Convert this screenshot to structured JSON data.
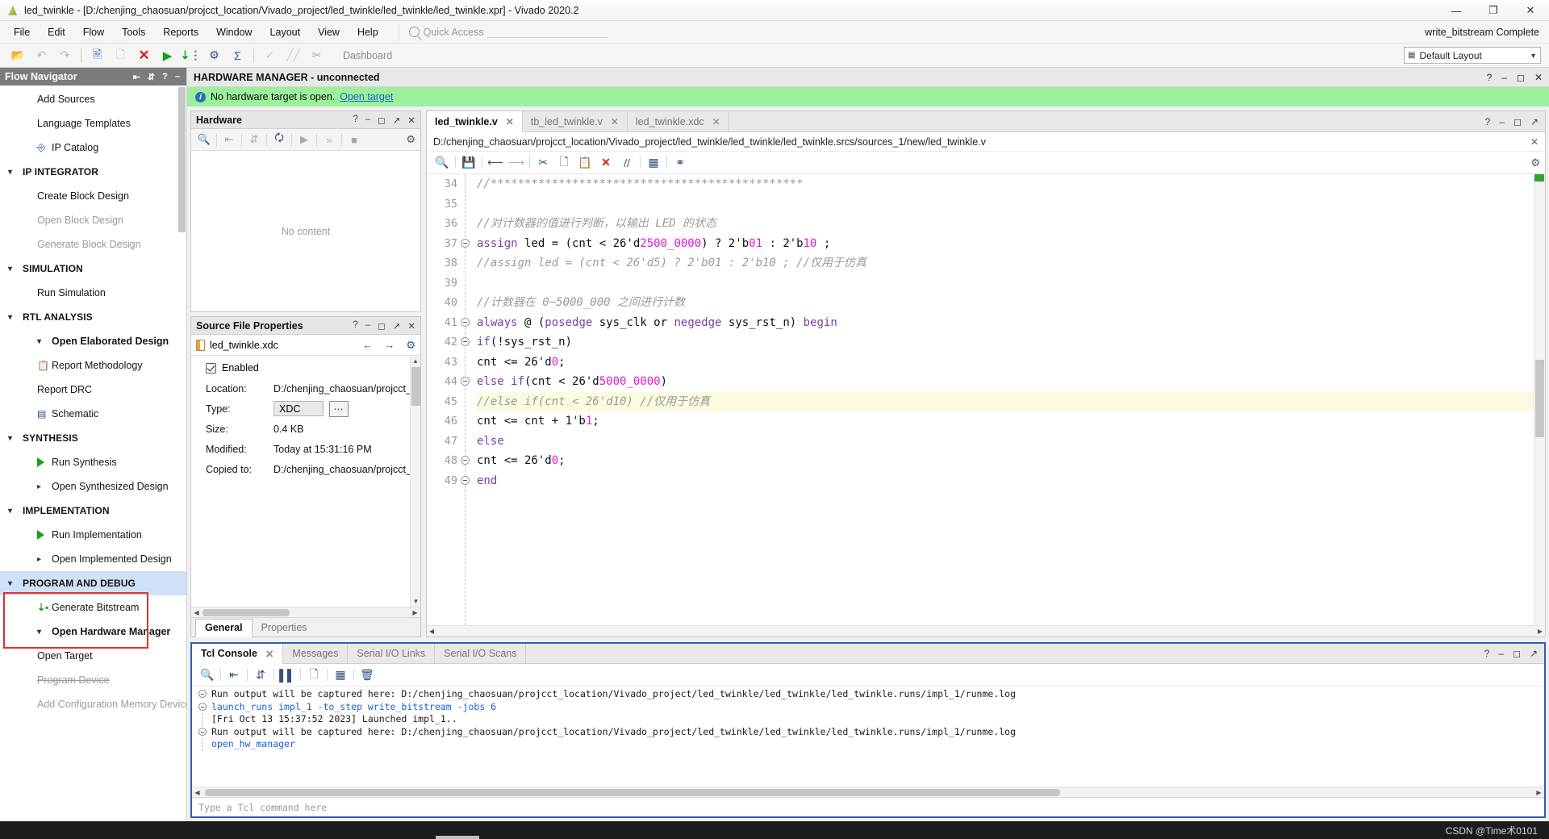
{
  "window": {
    "title": "led_twinkle - [D:/chenjing_chaosuan/projcct_location/Vivado_project/led_twinkle/led_twinkle/led_twinkle.xpr] - Vivado 2020.2",
    "minimize": "—",
    "maximize": "❐",
    "close": "✕"
  },
  "menubar": {
    "items": [
      "File",
      "Edit",
      "Flow",
      "Tools",
      "Reports",
      "Window",
      "Layout",
      "View",
      "Help"
    ],
    "quick_access_placeholder": "Quick Access",
    "bitstream_status": "write_bitstream Complete"
  },
  "toolbar": {
    "dashboard_label": "Dashboard",
    "layout_value": "Default Layout",
    "icons": [
      "open-folder",
      "undo",
      "redo",
      "report",
      "copy",
      "cancel",
      "run",
      "bitstream",
      "settings",
      "sum",
      "validate",
      "edit",
      "cut"
    ]
  },
  "flow_navigator": {
    "title": "Flow Navigator",
    "items": [
      {
        "label": "Add Sources",
        "indent": 1,
        "style": "normal",
        "icon": ""
      },
      {
        "label": "Language Templates",
        "indent": 1,
        "style": "normal",
        "icon": ""
      },
      {
        "label": "IP Catalog",
        "indent": 1,
        "style": "normal",
        "icon": "ip-catalog-icon"
      },
      {
        "label": "IP INTEGRATOR",
        "indent": 0,
        "style": "group",
        "icon": "chevron-down-icon"
      },
      {
        "label": "Create Block Design",
        "indent": 1,
        "style": "normal",
        "icon": ""
      },
      {
        "label": "Open Block Design",
        "indent": 1,
        "style": "dim",
        "icon": ""
      },
      {
        "label": "Generate Block Design",
        "indent": 1,
        "style": "dim",
        "icon": ""
      },
      {
        "label": "SIMULATION",
        "indent": 0,
        "style": "group",
        "icon": "chevron-down-icon"
      },
      {
        "label": "Run Simulation",
        "indent": 1,
        "style": "normal",
        "icon": ""
      },
      {
        "label": "RTL ANALYSIS",
        "indent": 0,
        "style": "group",
        "icon": "chevron-down-icon"
      },
      {
        "label": "Open Elaborated Design",
        "indent": 1,
        "style": "bold",
        "icon": "chevron-down-icon"
      },
      {
        "label": "Report Methodology",
        "indent": 2,
        "style": "normal",
        "icon": "clipboard-icon"
      },
      {
        "label": "Report DRC",
        "indent": 2,
        "style": "normal",
        "icon": ""
      },
      {
        "label": "Schematic",
        "indent": 2,
        "style": "normal",
        "icon": "schematic-icon"
      },
      {
        "label": "SYNTHESIS",
        "indent": 0,
        "style": "group",
        "icon": "chevron-down-icon"
      },
      {
        "label": "Run Synthesis",
        "indent": 1,
        "style": "normal",
        "icon": "run-icon"
      },
      {
        "label": "Open Synthesized Design",
        "indent": 1,
        "style": "normal",
        "icon": "chevron-right-icon"
      },
      {
        "label": "IMPLEMENTATION",
        "indent": 0,
        "style": "group",
        "icon": "chevron-down-icon"
      },
      {
        "label": "Run Implementation",
        "indent": 1,
        "style": "normal",
        "icon": "run-icon"
      },
      {
        "label": "Open Implemented Design",
        "indent": 1,
        "style": "normal",
        "icon": "chevron-right-icon"
      },
      {
        "label": "PROGRAM AND DEBUG",
        "indent": 0,
        "style": "group-highlight",
        "icon": "chevron-down-icon"
      },
      {
        "label": "Generate Bitstream",
        "indent": 1,
        "style": "normal",
        "icon": "bitstream-icon"
      },
      {
        "label": "Open Hardware Manager",
        "indent": 1,
        "style": "bold",
        "icon": "chevron-down-icon"
      },
      {
        "label": "Open Target",
        "indent": 2,
        "style": "normal",
        "icon": ""
      },
      {
        "label": "Program Device",
        "indent": 2,
        "style": "strike",
        "icon": ""
      },
      {
        "label": "Add Configuration Memory Device",
        "indent": 2,
        "style": "dim",
        "icon": ""
      }
    ]
  },
  "hardware_manager": {
    "header": "HARDWARE MANAGER - unconnected",
    "notice_text": "No hardware target is open.",
    "notice_link": "Open target"
  },
  "hardware_panel": {
    "title": "Hardware",
    "empty_text": "No content",
    "tools": [
      "search-icon",
      "collapse-icon",
      "expand-icon",
      "refresh-icon",
      "run-icon",
      "more-icon",
      "stop-icon"
    ]
  },
  "source_file_properties": {
    "title": "Source File Properties",
    "file_name": "led_twinkle.xdc",
    "enabled_label": "Enabled",
    "rows": [
      {
        "label": "Location:",
        "value": "D:/chenjing_chaosuan/projcct_locatio"
      },
      {
        "label": "Type:",
        "value": "XDC"
      },
      {
        "label": "Size:",
        "value": "0.4 KB"
      },
      {
        "label": "Modified:",
        "value": "Today at 15:31:16 PM"
      },
      {
        "label": "Copied to:",
        "value": "D:/chenjing_chaosuan/projcct_locatio"
      }
    ],
    "tabs": [
      "General",
      "Properties"
    ],
    "active_tab": "General"
  },
  "editor": {
    "tabs": [
      {
        "label": "led_twinkle.v",
        "active": true
      },
      {
        "label": "tb_led_twinkle.v",
        "active": false
      },
      {
        "label": "led_twinkle.xdc",
        "active": false
      }
    ],
    "path": "D:/chenjing_chaosuan/projcct_location/Vivado_project/led_twinkle/led_twinkle/led_twinkle.srcs/sources_1/new/led_twinkle.v",
    "tools": [
      "search-icon",
      "save-icon",
      "undo-icon",
      "redo-icon",
      "cut-icon",
      "copy-icon",
      "paste-icon",
      "delete-icon",
      "comment-icon",
      "indent-icon",
      "bulb-icon"
    ],
    "code_lines": [
      {
        "n": 34,
        "fold": false,
        "highlight": false,
        "tokens": [
          {
            "t": "//**********************************************",
            "c": "com"
          }
        ]
      },
      {
        "n": 35,
        "fold": false,
        "highlight": false,
        "tokens": []
      },
      {
        "n": 36,
        "fold": false,
        "highlight": false,
        "tokens": [
          {
            "t": "//对计数器的值进行判断，以输出 LED 的状态",
            "c": "com"
          }
        ]
      },
      {
        "n": 37,
        "fold": true,
        "highlight": false,
        "tokens": [
          {
            "t": "assign",
            "c": "kw"
          },
          {
            "t": " led = (cnt < 26'd",
            "c": "txt"
          },
          {
            "t": "2500_0000",
            "c": "num"
          },
          {
            "t": ") ? 2'b",
            "c": "txt"
          },
          {
            "t": "01",
            "c": "num"
          },
          {
            "t": " : 2'b",
            "c": "txt"
          },
          {
            "t": "10",
            "c": "num"
          },
          {
            "t": " ;",
            "c": "txt"
          }
        ]
      },
      {
        "n": 38,
        "fold": false,
        "highlight": false,
        "tokens": [
          {
            "t": "//assign led = (cnt < 26'd5) ? 2'b01 : 2'b10 ; //仅用于仿真",
            "c": "com"
          }
        ]
      },
      {
        "n": 39,
        "fold": false,
        "highlight": false,
        "tokens": []
      },
      {
        "n": 40,
        "fold": false,
        "highlight": false,
        "tokens": [
          {
            "t": "//计数器在 0~5000_000 之间进行计数",
            "c": "com"
          }
        ]
      },
      {
        "n": 41,
        "fold": true,
        "highlight": false,
        "tokens": [
          {
            "t": "always",
            "c": "kw"
          },
          {
            "t": " @ (",
            "c": "txt"
          },
          {
            "t": "posedge",
            "c": "kw"
          },
          {
            "t": " sys_clk or ",
            "c": "txt"
          },
          {
            "t": "negedge",
            "c": "kw"
          },
          {
            "t": " sys_rst_n) ",
            "c": "txt"
          },
          {
            "t": "begin",
            "c": "kw"
          }
        ]
      },
      {
        "n": 42,
        "fold": true,
        "highlight": false,
        "tokens": [
          {
            "t": "if",
            "c": "kw"
          },
          {
            "t": "(!sys_rst_n)",
            "c": "txt"
          }
        ]
      },
      {
        "n": 43,
        "fold": false,
        "highlight": false,
        "tokens": [
          {
            "t": "cnt <= 26'd",
            "c": "txt"
          },
          {
            "t": "0",
            "c": "num"
          },
          {
            "t": ";",
            "c": "txt"
          }
        ]
      },
      {
        "n": 44,
        "fold": true,
        "highlight": false,
        "tokens": [
          {
            "t": "else",
            "c": "kw"
          },
          {
            "t": " ",
            "c": "txt"
          },
          {
            "t": "if",
            "c": "kw"
          },
          {
            "t": "(cnt < 26'd",
            "c": "txt"
          },
          {
            "t": "5000_0000",
            "c": "num"
          },
          {
            "t": ")",
            "c": "txt"
          }
        ]
      },
      {
        "n": 45,
        "fold": false,
        "highlight": true,
        "tokens": [
          {
            "t": "//else if(cnt < 26'd10) //仅用于仿真",
            "c": "com"
          }
        ]
      },
      {
        "n": 46,
        "fold": false,
        "highlight": false,
        "tokens": [
          {
            "t": "cnt <= cnt + 1'b",
            "c": "txt"
          },
          {
            "t": "1",
            "c": "num"
          },
          {
            "t": ";",
            "c": "txt"
          }
        ]
      },
      {
        "n": 47,
        "fold": false,
        "highlight": false,
        "tokens": [
          {
            "t": "else",
            "c": "kw"
          }
        ]
      },
      {
        "n": 48,
        "fold": true,
        "highlight": false,
        "tokens": [
          {
            "t": "cnt <= 26'd",
            "c": "txt"
          },
          {
            "t": "0",
            "c": "num"
          },
          {
            "t": ";",
            "c": "txt"
          }
        ]
      },
      {
        "n": 49,
        "fold": true,
        "highlight": false,
        "tokens": [
          {
            "t": "end",
            "c": "kw"
          }
        ]
      }
    ]
  },
  "console": {
    "tabs": [
      {
        "label": "Tcl Console",
        "active": true,
        "closable": true
      },
      {
        "label": "Messages",
        "active": false,
        "closable": false
      },
      {
        "label": "Serial I/O Links",
        "active": false,
        "closable": false
      },
      {
        "label": "Serial I/O Scans",
        "active": false,
        "closable": false
      }
    ],
    "tools": [
      "search-icon",
      "collapse-icon",
      "expand-icon",
      "pause-icon",
      "copy-icon",
      "wrap-icon",
      "clear-icon"
    ],
    "lines": [
      {
        "fold": true,
        "color": "black",
        "text": "Run output will be captured here: D:/chenjing_chaosuan/projcct_location/Vivado_project/led_twinkle/led_twinkle/led_twinkle.runs/impl_1/runme.log"
      },
      {
        "fold": true,
        "color": "blue",
        "text": "launch_runs impl_1 -to_step write_bitstream -jobs 6"
      },
      {
        "fold": false,
        "color": "black",
        "text": "[Fri Oct 13 15:37:52 2023] Launched impl_1.."
      },
      {
        "fold": true,
        "color": "black",
        "text": "Run output will be captured here: D:/chenjing_chaosuan/projcct_location/Vivado_project/led_twinkle/led_twinkle/led_twinkle.runs/impl_1/runme.log"
      },
      {
        "fold": false,
        "color": "blue",
        "text": "open_hw_manager"
      }
    ],
    "input_placeholder": "Type a Tcl command here"
  },
  "statusbar": {
    "watermark": "CSDN @Time术0101"
  },
  "colors": {
    "accent_blue": "#2f5fb0",
    "notice_green": "#9cf09c",
    "highlight_blue": "#cfe0f7",
    "red_box": "#e03030",
    "keyword_purple": "#7b3fa0",
    "number_magenta": "#e01ad6",
    "comment_gray": "#9a9a9a"
  }
}
